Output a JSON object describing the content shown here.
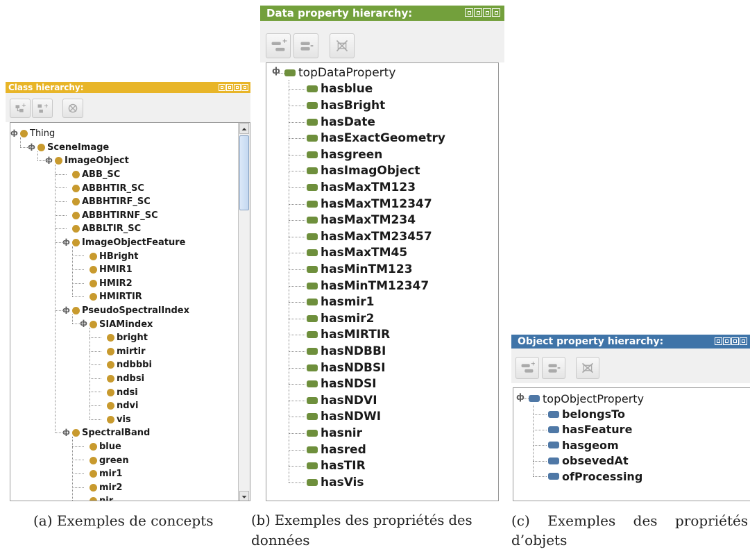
{
  "colors": {
    "class_title_bg": "#e8b528",
    "data_title_bg": "#73a03c",
    "object_title_bg": "#3f74a8",
    "class_node": "#c89a2e",
    "data_prop": "#6e8f3c",
    "object_prop": "#4f78a6"
  },
  "class_panel": {
    "title": "Class hierarchy:",
    "toolbar_icons": [
      "add-subclass-icon",
      "add-sibling-class-icon",
      "delete-class-icon"
    ],
    "tree": [
      {
        "label": "Thing",
        "depth": 0,
        "expandable": true
      },
      {
        "label": "SceneImage",
        "depth": 1,
        "expandable": true
      },
      {
        "label": "ImageObject",
        "depth": 2,
        "expandable": true
      },
      {
        "label": "ABB_SC",
        "depth": 3,
        "expandable": false
      },
      {
        "label": "ABBHTIR_SC",
        "depth": 3,
        "expandable": false
      },
      {
        "label": "ABBHTIRF_SC",
        "depth": 3,
        "expandable": false
      },
      {
        "label": "ABBHTIRNF_SC",
        "depth": 3,
        "expandable": false
      },
      {
        "label": "ABBLTIR_SC",
        "depth": 3,
        "expandable": false
      },
      {
        "label": "ImageObjectFeature",
        "depth": 3,
        "expandable": true
      },
      {
        "label": "HBright",
        "depth": 4,
        "expandable": false
      },
      {
        "label": "HMIR1",
        "depth": 4,
        "expandable": false
      },
      {
        "label": "HMIR2",
        "depth": 4,
        "expandable": false
      },
      {
        "label": "HMIRTIR",
        "depth": 4,
        "expandable": false
      },
      {
        "label": "PseudoSpectralIndex",
        "depth": 3,
        "expandable": true
      },
      {
        "label": "SIAMindex",
        "depth": 4,
        "expandable": true
      },
      {
        "label": "bright",
        "depth": 5,
        "expandable": false
      },
      {
        "label": "mirtir",
        "depth": 5,
        "expandable": false
      },
      {
        "label": "ndbbbi",
        "depth": 5,
        "expandable": false
      },
      {
        "label": "ndbsi",
        "depth": 5,
        "expandable": false
      },
      {
        "label": "ndsi",
        "depth": 5,
        "expandable": false
      },
      {
        "label": "ndvi",
        "depth": 5,
        "expandable": false
      },
      {
        "label": "vis",
        "depth": 5,
        "expandable": false
      },
      {
        "label": "SpectralBand",
        "depth": 3,
        "expandable": true
      },
      {
        "label": "blue",
        "depth": 4,
        "expandable": false
      },
      {
        "label": "green",
        "depth": 4,
        "expandable": false
      },
      {
        "label": "mir1",
        "depth": 4,
        "expandable": false
      },
      {
        "label": "mir2",
        "depth": 4,
        "expandable": false
      },
      {
        "label": "nir",
        "depth": 4,
        "expandable": false
      }
    ]
  },
  "data_panel": {
    "title": "Data property hierarchy:",
    "toolbar_icons": [
      "add-sub-property-icon",
      "add-sibling-property-icon",
      "delete-property-icon"
    ],
    "root": "topDataProperty",
    "children": [
      "hasblue",
      "hasBright",
      "hasDate",
      "hasExactGeometry",
      "hasgreen",
      "hasImagObject",
      "hasMaxTM123",
      "hasMaxTM12347",
      "hasMaxTM234",
      "hasMaxTM23457",
      "hasMaxTM45",
      "hasMinTM123",
      "hasMinTM12347",
      "hasmir1",
      "hasmir2",
      "hasMIRTIR",
      "hasNDBBI",
      "hasNDBSI",
      "hasNDSI",
      "hasNDVI",
      "hasNDWI",
      "hasnir",
      "hasred",
      "hasTIR",
      "hasVis"
    ]
  },
  "object_panel": {
    "title": "Object property hierarchy:",
    "toolbar_icons": [
      "add-sub-property-icon",
      "add-sibling-property-icon",
      "delete-property-icon"
    ],
    "root": "topObjectProperty",
    "children": [
      "belongsTo",
      "hasFeature",
      "hasgeom",
      "obsevedAt",
      "ofProcessing"
    ]
  },
  "captions": {
    "a": "(a) Exemples de concepts",
    "b_line1": "(b) Exemples des propriétés des",
    "b_line2": "données",
    "c_line1": "(c)    Exemples    des    propriétés",
    "c_line2": "d’objets"
  }
}
